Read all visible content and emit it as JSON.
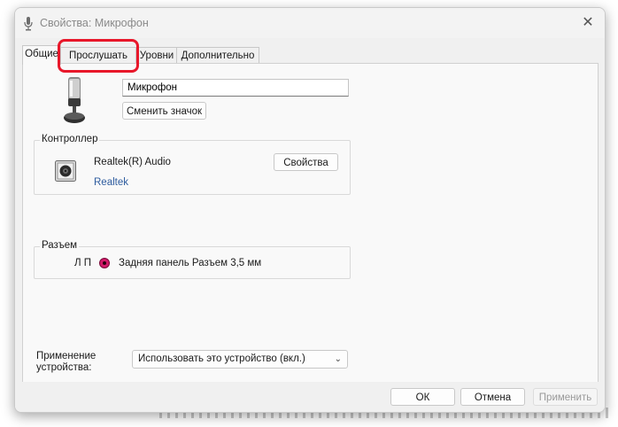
{
  "window": {
    "title": "Свойства: Микрофон",
    "title_icon": "microphone-icon",
    "close_icon": "close-icon",
    "close_glyph": "✕"
  },
  "tabs": [
    {
      "label": "Общие",
      "active": true
    },
    {
      "label": "Прослушать",
      "active": false
    },
    {
      "label": "Уровни",
      "active": false
    },
    {
      "label": "Дополнительно",
      "active": false
    }
  ],
  "general": {
    "device_name_value": "Микрофон",
    "change_icon_label": "Сменить значок",
    "device_image": "microphone-image"
  },
  "controller": {
    "group_label": "Контроллер",
    "name": "Realtek(R) Audio",
    "link": "Realtek",
    "properties_label": "Свойства",
    "icon": "speaker-icon"
  },
  "jack": {
    "group_label": "Разъем",
    "channels": "Л П",
    "description": "Задняя панель Разъем 3,5 мм",
    "color": "#d3196a"
  },
  "usage": {
    "label": "Применение устройства:",
    "selected": "Использовать это устройство (вкл.)"
  },
  "footer": {
    "ok_label": "ОК",
    "cancel_label": "Отмена",
    "apply_label": "Применить"
  },
  "colors": {
    "highlight": "#e8172a",
    "link": "#2e5c9e"
  }
}
